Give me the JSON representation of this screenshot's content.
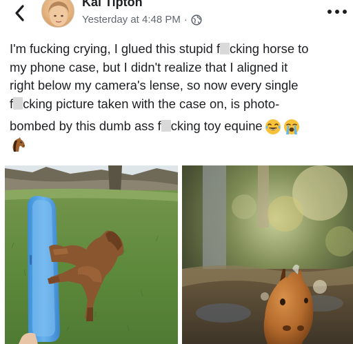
{
  "header": {
    "author": "Kai Tipton",
    "timestamp": "Yesterday at 4:48 PM",
    "separator": "·",
    "privacy_icon": "globe-icon",
    "back_icon": "chevron-left-icon",
    "more_icon": "more-options-icon"
  },
  "post": {
    "lines": [
      "I'm fucking crying, I glued this stupid f██cking horse to",
      "my phone case, but I didn't realize that I aligned it",
      "right below my camera's lense, so now every single",
      "f██cking picture taken with the case on, is photo-",
      "bombed by this dumb ass f██cking toy equine"
    ],
    "emojis": [
      "tears-of-joy-emoji",
      "loudly-crying-emoji",
      "horse-face-emoji"
    ]
  },
  "photos": [
    {
      "description_icon": "phone-with-toy-horse-photo"
    },
    {
      "description_icon": "toy-horse-photobomb-photo"
    }
  ],
  "colors": {
    "text": "#1c1e21",
    "meta": "#606770",
    "censor": "#d9d9d9"
  }
}
